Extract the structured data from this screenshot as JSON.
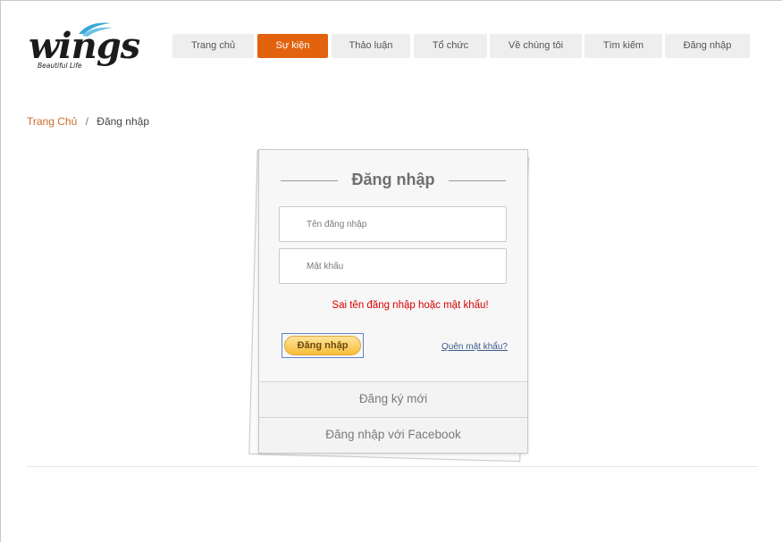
{
  "brand": {
    "logo_text": "wings",
    "tagline": "Beautiful Life"
  },
  "nav": {
    "items": [
      {
        "label": "Trang chủ",
        "active": false
      },
      {
        "label": "Sự kiện",
        "active": true
      },
      {
        "label": "Thảo luận",
        "active": false
      },
      {
        "label": "Tổ chức",
        "active": false
      },
      {
        "label": "Về chúng tôi",
        "active": false
      },
      {
        "label": "Tìm kiếm",
        "active": false
      },
      {
        "label": "Đăng nhập",
        "active": false
      }
    ]
  },
  "breadcrumb": {
    "home": "Trang Chủ",
    "separator": "/",
    "current": "Đăng nhập"
  },
  "login": {
    "title": "Đăng nhập",
    "username_placeholder": "Tên đăng nhập",
    "username_value": "",
    "password_placeholder": "Mật khẩu",
    "password_value": "",
    "error_message": "Sai tên đăng nhập hoặc mật khẩu!",
    "submit_label": "Đăng nhập",
    "forgot_label": "Quên mật khẩu?",
    "register_label": "Đăng ký mới",
    "facebook_label": "Đăng nhập với Facebook"
  },
  "colors": {
    "accent": "#e2620e",
    "error": "#d90000",
    "link": "#3c5b8d",
    "button": "#f9be3c"
  }
}
